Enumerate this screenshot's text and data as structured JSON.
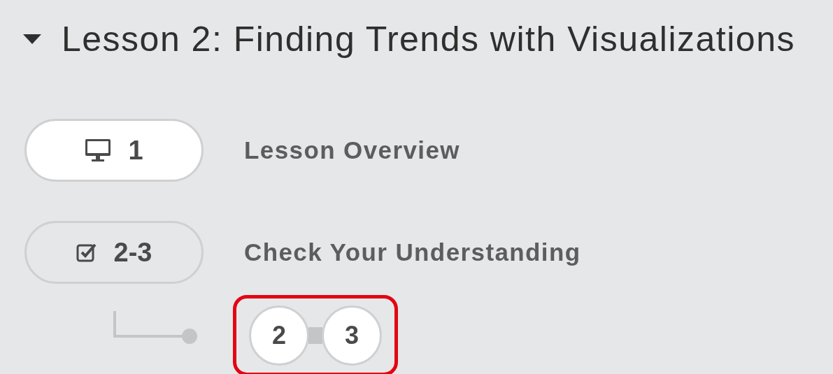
{
  "lesson": {
    "title": "Lesson 2: Finding Trends with Visualizations",
    "expanded": true
  },
  "levels": [
    {
      "kind": "overview",
      "number": "1",
      "title": "Lesson Overview",
      "selected": true
    },
    {
      "kind": "check",
      "number": "2-3",
      "title": "Check Your Understanding",
      "selected": false
    }
  ],
  "sublevels": {
    "highlighted": true,
    "bubbles": [
      {
        "number": "2"
      },
      {
        "number": "3"
      }
    ]
  }
}
